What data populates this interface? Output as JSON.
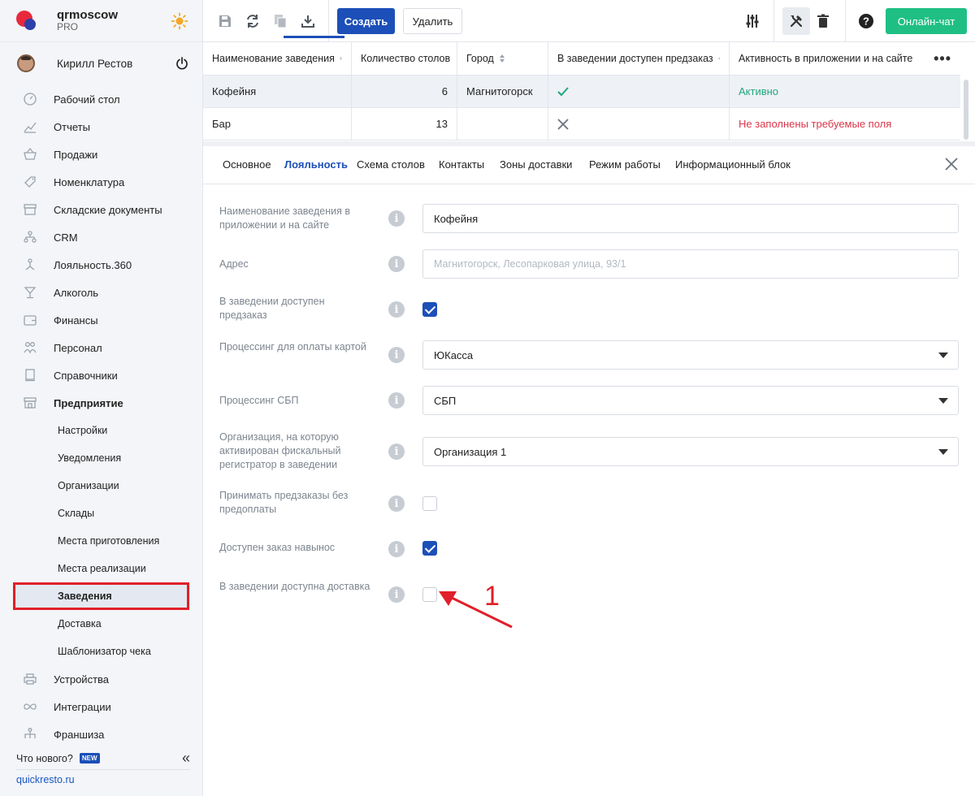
{
  "brand": {
    "name": "qrmoscow",
    "plan": "PRO"
  },
  "user": {
    "name": "Кирилл Рестов"
  },
  "nav": [
    {
      "label": "Рабочий стол",
      "icon": "dashboard-icon"
    },
    {
      "label": "Отчеты",
      "icon": "reports-icon"
    },
    {
      "label": "Продажи",
      "icon": "basket-icon"
    },
    {
      "label": "Номенклатура",
      "icon": "tag-icon"
    },
    {
      "label": "Складские документы",
      "icon": "archive-icon"
    },
    {
      "label": "CRM",
      "icon": "crm-icon"
    },
    {
      "label": "Лояльность.360",
      "icon": "loyalty-icon"
    },
    {
      "label": "Алкоголь",
      "icon": "glass-icon"
    },
    {
      "label": "Финансы",
      "icon": "wallet-icon"
    },
    {
      "label": "Персонал",
      "icon": "people-icon"
    },
    {
      "label": "Справочники",
      "icon": "book-icon"
    },
    {
      "label": "Предприятие",
      "icon": "store-icon"
    }
  ],
  "subnav": [
    "Настройки",
    "Уведомления",
    "Организации",
    "Склады",
    "Места приготовления",
    "Места реализации",
    "Заведения",
    "Доставка",
    "Шаблонизатор чека"
  ],
  "nav_bottom": [
    {
      "label": "Устройства",
      "icon": "printer-icon"
    },
    {
      "label": "Интеграции",
      "icon": "infinity-icon"
    },
    {
      "label": "Франшиза",
      "icon": "franchise-icon"
    }
  ],
  "whatsnew": {
    "label": "Что нового?",
    "badge": "NEW"
  },
  "site": "quickresto.ru",
  "toolbar": {
    "create": "Создать",
    "delete": "Удалить",
    "chat": "Онлайн-чат"
  },
  "table": {
    "headers": [
      "Наименование заведения",
      "Количество столов",
      "Город",
      "В заведении доступен предзаказ",
      "Активность в приложении и на сайте"
    ],
    "rows": [
      {
        "name": "Кофейня",
        "tables": "6",
        "city": "Магнитогорск",
        "status": "Активно"
      },
      {
        "name": "Бар",
        "tables": "13",
        "city": "",
        "status": "Не заполнены требуемые поля"
      }
    ]
  },
  "tabs": [
    "Основное",
    "Лояльность",
    "Схема столов",
    "Контакты",
    "Зоны доставки",
    "Режим работы",
    "Информационный блок"
  ],
  "form": {
    "name_label": "Наименование заведения в приложении и на сайте",
    "name_value": "Кофейня",
    "address_label": "Адрес",
    "address_placeholder": "Магнитогорск, Лесопарковая улица, 93/1",
    "preorder_label": "В заведении доступен предзаказ",
    "card_label": "Процессинг для оплаты картой",
    "card_value": "ЮКасса",
    "sbp_label": "Процессинг СБП",
    "sbp_value": "СБП",
    "fiscal_label": "Организация, на которую активирован фискальный регистратор в заведении",
    "fiscal_value": "Организация 1",
    "noprepay_label": "Принимать предзаказы без предоплаты",
    "takeaway_label": "Доступен заказ навынос",
    "delivery_label": "В заведении доступна доставка"
  },
  "annotation": "1",
  "colors": {
    "primary": "#1c4fb8",
    "success": "#1fbf84",
    "error": "#d9364a",
    "highlight": "#e0202a"
  }
}
